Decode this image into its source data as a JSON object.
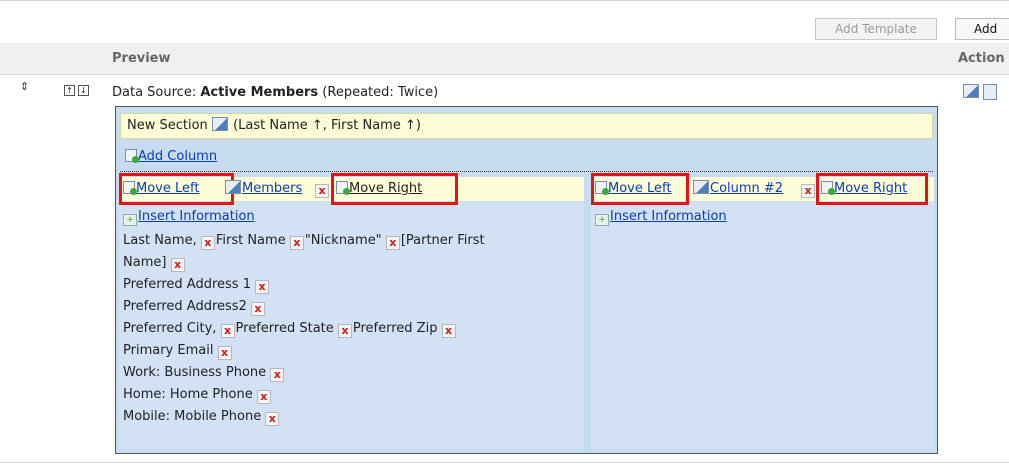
{
  "toolbar": {
    "add_template": "Add Template",
    "add": "Add"
  },
  "header": {
    "preview": "Preview",
    "actions": "Action"
  },
  "row": {
    "data_source_prefix": "Data Source: ",
    "data_source_name": "Active Members",
    "repeated": " (Repeated: Twice)",
    "reorder_icon": "⇕",
    "move_up_icon": "↑",
    "move_down_icon": "↓"
  },
  "section": {
    "title": "New Section",
    "sort": "(Last Name ↑, First Name ↑)",
    "add_column": "Add Column"
  },
  "columns": [
    {
      "move_left": "Move Left",
      "name": "Members",
      "move_right": "Move Right",
      "insert": "Insert Information",
      "fields": {
        "last_name": "Last Name, ",
        "first_name": "First Name ",
        "nickname": "\"Nickname\" ",
        "partner_a": "[Partner First",
        "partner_b": "Name] ",
        "addr1": "Preferred Address 1 ",
        "addr2": "Preferred Address2 ",
        "city": "Preferred City, ",
        "state": "Preferred State ",
        "zip": "Preferred Zip ",
        "email": "Primary Email ",
        "work": "Work: Business Phone ",
        "home": "Home: Home Phone ",
        "mobile": "Mobile: Mobile Phone "
      }
    },
    {
      "move_left": "Move Left",
      "name": "Column #2",
      "move_right": "Move Right",
      "insert": "Insert Information"
    }
  ],
  "icons": {
    "delete_glyph": "x",
    "plus_glyph": "+"
  },
  "colors": {
    "highlight": "#e5141b",
    "link": "#0b3fb5",
    "section_bg": "#fdfdd7",
    "panel_bg": "#c7dbf1"
  }
}
